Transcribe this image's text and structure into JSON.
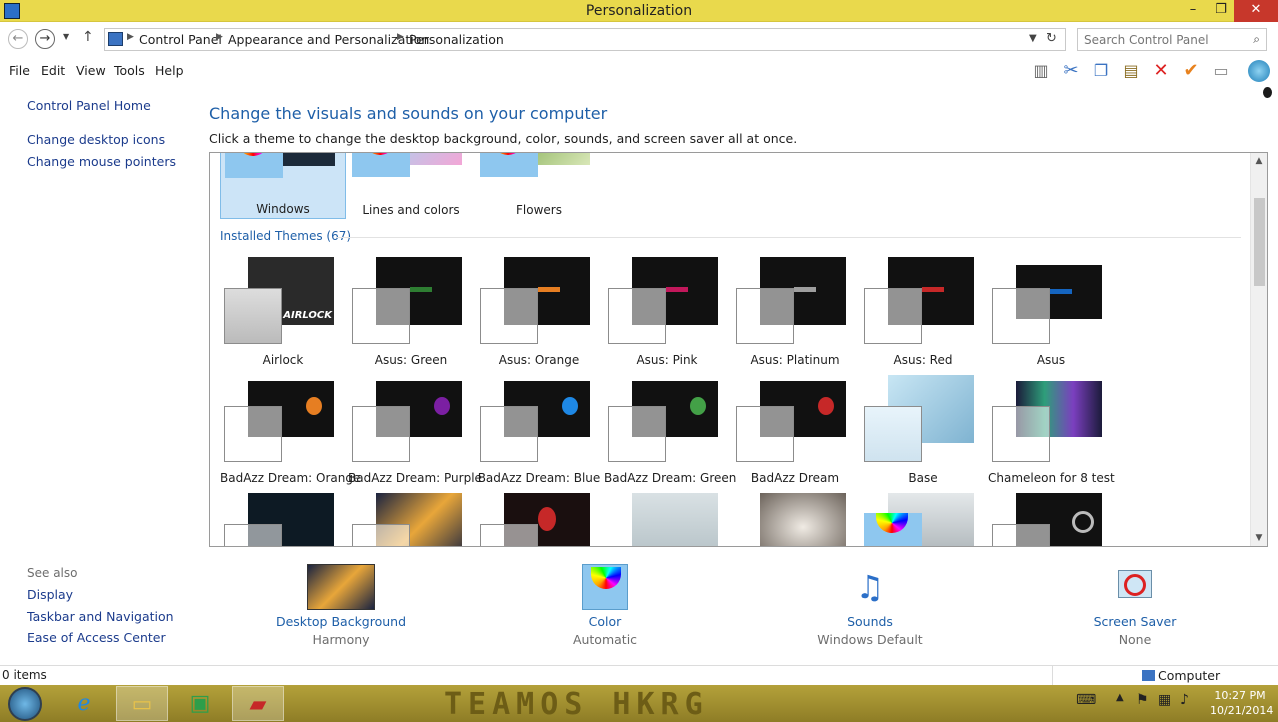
{
  "window": {
    "title": "Personalization",
    "min": "–",
    "max": "❐",
    "close": "✕"
  },
  "address": {
    "crumbs": [
      "Control Panel",
      "Appearance and Personalization",
      "Personalization"
    ],
    "search_placeholder": "Search Control Panel"
  },
  "menu": [
    "File",
    "Edit",
    "View",
    "Tools",
    "Help"
  ],
  "toolbar_icons": [
    "layout-icon",
    "cut-icon",
    "copy-icon",
    "paste-icon",
    "delete-icon",
    "check-icon",
    "properties-icon",
    "globe-icon"
  ],
  "leftnav": {
    "home": "Control Panel Home",
    "desktop_icons": "Change desktop icons",
    "mouse_pointers": "Change mouse pointers",
    "see_also": "See also",
    "display": "Display",
    "taskbar": "Taskbar and Navigation",
    "ease": "Ease of Access Center"
  },
  "main": {
    "heading": "Change the visuals and sounds on your computer",
    "subheading": "Click a theme to change the desktop background, color, sounds, and screen saver all at once.",
    "default_themes": [
      "Windows",
      "Lines and colors",
      "Flowers"
    ],
    "installed_title": "Installed Themes (67)",
    "installed_row1": [
      "Airlock",
      "Asus: Green",
      "Asus: Orange",
      "Asus: Pink",
      "Asus: Platinum",
      "Asus: Red",
      "Asus"
    ],
    "installed_row2": [
      "BadAzz Dream: Orange",
      "BadAzz Dream: Purple",
      "BadAzz Dream: Blue",
      "BadAzz Dream: Green",
      "BadAzz Dream",
      "Base",
      "Chameleon for 8 test"
    ],
    "accent_colors": {
      "asus_green": "#2e7d32",
      "asus_orange": "#e67e22",
      "asus_pink": "#c2185b",
      "asus_platinum": "#9e9e9e",
      "asus_red": "#c62828",
      "asus": "#1565c0",
      "badazz_orange": "#e67e22",
      "badazz_purple": "#7b1fa2",
      "badazz_blue": "#1e88e5",
      "badazz_green": "#43a047",
      "badazz": "#c62828"
    }
  },
  "bottom": {
    "background_label": "Desktop Background",
    "background_value": "Harmony",
    "color_label": "Color",
    "color_value": "Automatic",
    "sounds_label": "Sounds",
    "sounds_value": "Windows Default",
    "saver_label": "Screen Saver",
    "saver_value": "None"
  },
  "status": {
    "items": "0 items",
    "computer": "Computer"
  },
  "taskbar": {
    "brand": "TEAMOS HKRG",
    "time": "10:27 PM",
    "date": "10/21/2014"
  }
}
